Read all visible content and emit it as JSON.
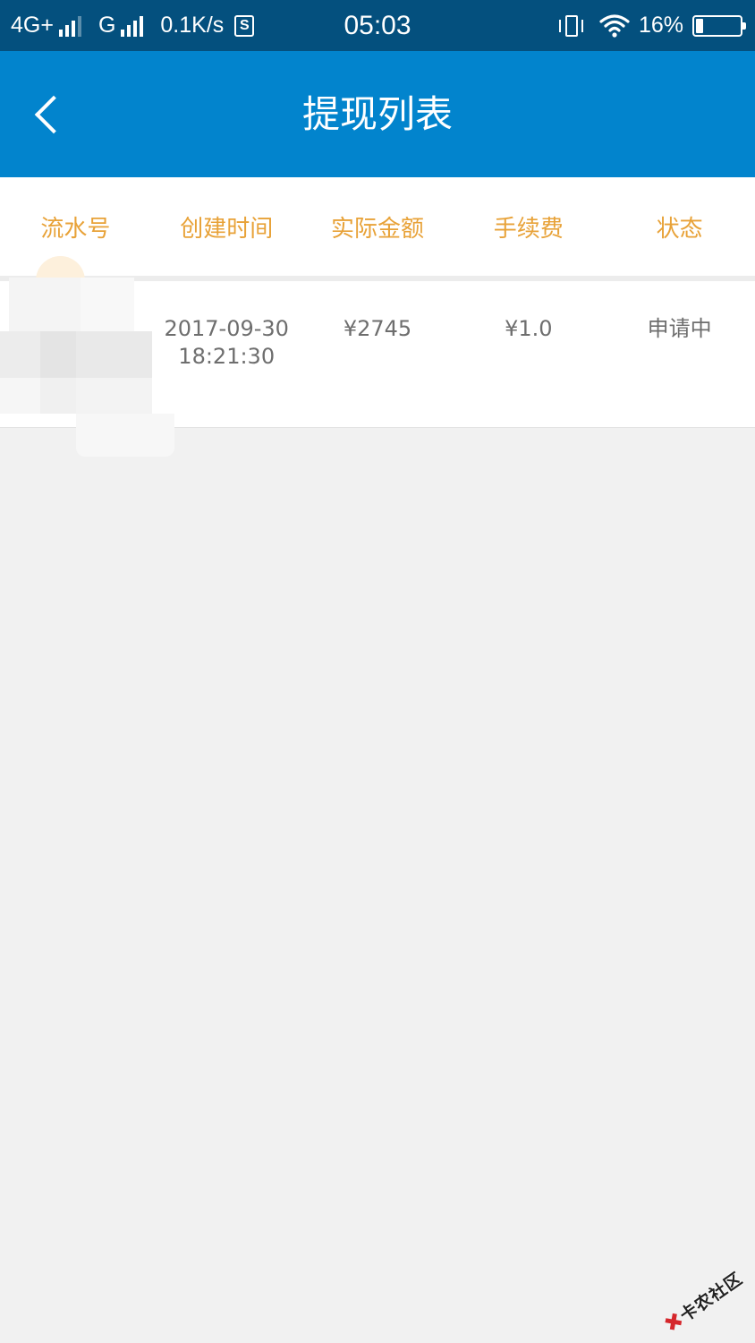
{
  "status_bar": {
    "network_1": "4G+",
    "network_2": "G",
    "speed": "0.1K/s",
    "s_icon": "S",
    "time": "05:03",
    "battery": "16%",
    "battery_level": 0.16
  },
  "header": {
    "title": "提现列表",
    "back_icon": "chevron-left-icon"
  },
  "table": {
    "columns": [
      "流水号",
      "创建时间",
      "实际金额",
      "手续费",
      "状态"
    ],
    "rows": [
      {
        "serial": "",
        "date": "2017-09-30",
        "time": "18:21:30",
        "amount": "¥2745",
        "fee": "¥1.0",
        "status": "申请中"
      }
    ]
  },
  "watermark": {
    "text": "卡农社区"
  },
  "colors": {
    "status_bar_bg": "#04507e",
    "header_bg": "#0284cd",
    "column_header_text": "#e8a238",
    "cell_text": "#6e6e6e",
    "page_bg": "#f1f1f1"
  }
}
